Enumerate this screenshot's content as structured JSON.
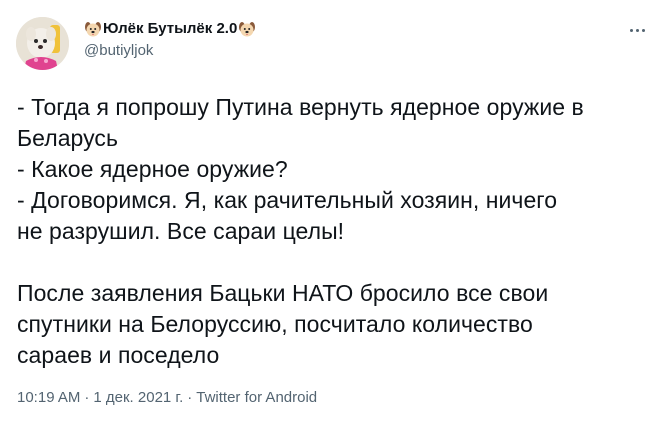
{
  "tweet": {
    "display_name": "Юлёк Бутылёк 2.0",
    "name_emoji_left": "dog-face-icon",
    "name_emoji_right": "dog-face-icon",
    "handle": "@butiyljok",
    "more_icon": "more-horizontal-icon",
    "text": "- Тогда я попрошу Путина вернуть ядерное оружие в\nБеларусь\n- Какое ядерное оружие?\n- Договоримся. Я, как рачительный хозяин, ничего\nне разрушил. Все сараи целы!\n\nПосле заявления Бацьки НАТО бросило все свои\nспутники на Белоруссию, посчитало количество\nсараев и поседело",
    "time": "10:19 AM",
    "date": "1 дек. 2021 г.",
    "source": "Twitter for Android",
    "separator": "·"
  },
  "colors": {
    "text_primary": "#0f1419",
    "text_secondary": "#536471",
    "background": "#ffffff"
  }
}
